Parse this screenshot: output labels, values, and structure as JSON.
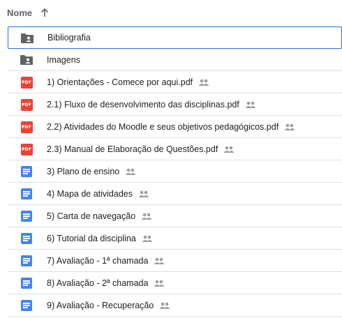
{
  "header": {
    "column_label": "Nome",
    "sort_icon": "arrow-up-icon"
  },
  "colors": {
    "pdf": "#ea4335",
    "doc": "#4285f4",
    "folder": "#5f6368",
    "selected_border": "#1a73e8"
  },
  "files": [
    {
      "name": "Bibliografia",
      "type": "folder",
      "shared": false,
      "selected": true
    },
    {
      "name": "Imagens",
      "type": "folder",
      "shared": false,
      "selected": false
    },
    {
      "name": "1) Orientações - Comece por aqui.pdf",
      "type": "pdf",
      "shared": true
    },
    {
      "name": "2.1) Fluxo de desenvolvimento das disciplinas.pdf",
      "type": "pdf",
      "shared": true
    },
    {
      "name": "2.2) Atividades do Moodle e seus objetivos pedagógicos.pdf",
      "type": "pdf",
      "shared": true
    },
    {
      "name": "2.3) Manual de Elaboração de Questões.pdf",
      "type": "pdf",
      "shared": true
    },
    {
      "name": "3) Plano de ensino",
      "type": "doc",
      "shared": true
    },
    {
      "name": "4) Mapa de atividades",
      "type": "doc",
      "shared": true
    },
    {
      "name": "5) Carta de navegação",
      "type": "doc",
      "shared": true
    },
    {
      "name": "6) Tutorial da disciplina",
      "type": "doc",
      "shared": true
    },
    {
      "name": "7) Avaliação - 1ª chamada",
      "type": "doc",
      "shared": true
    },
    {
      "name": "8) Avaliação - 2ª chamada",
      "type": "doc",
      "shared": true
    },
    {
      "name": "9) Avaliação - Recuperação",
      "type": "doc",
      "shared": true
    }
  ],
  "icons": {
    "pdf_badge": "PDF",
    "shared": "people-icon",
    "folder": "folder-shared-icon",
    "doc": "docs-icon"
  }
}
